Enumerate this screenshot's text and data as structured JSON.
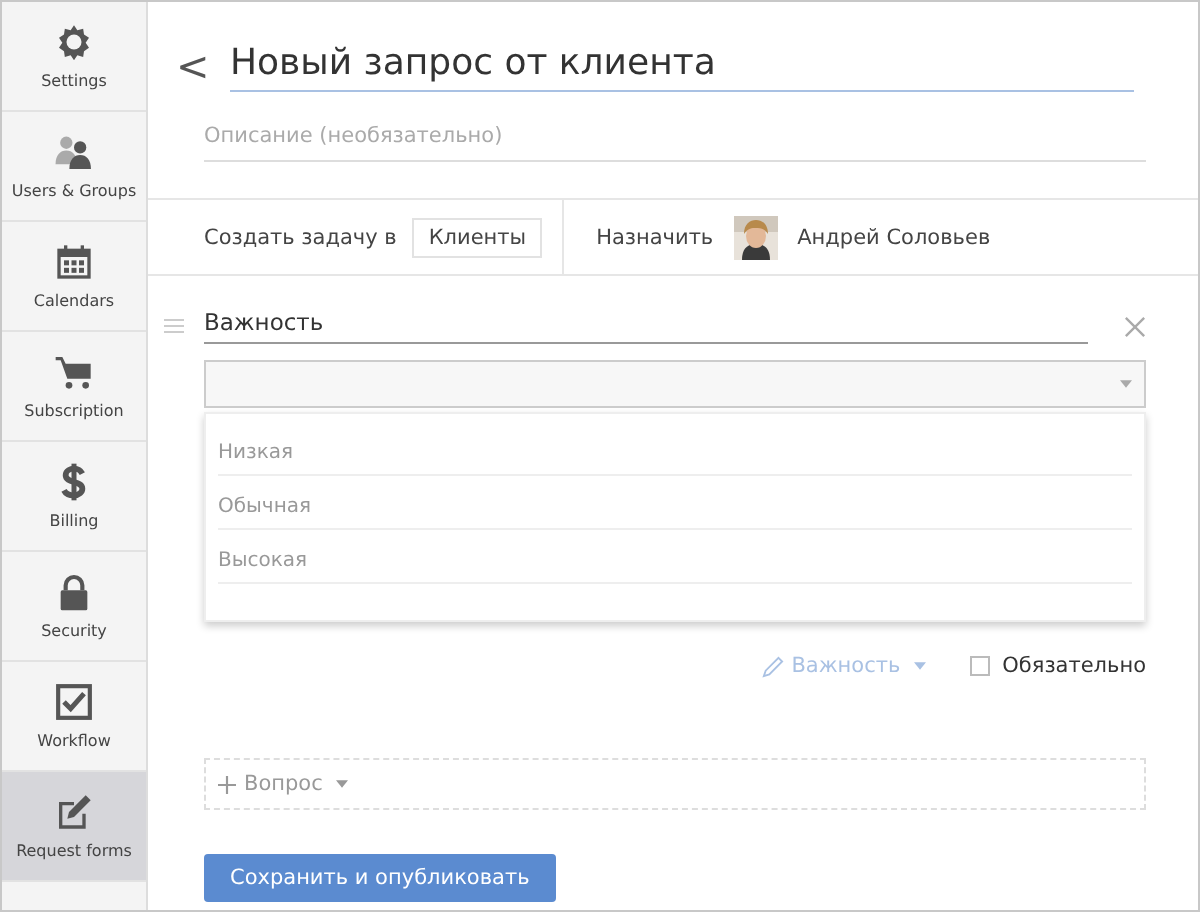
{
  "sidebar": {
    "items": [
      {
        "label": "Settings",
        "selected": false
      },
      {
        "label": "Users & Groups",
        "selected": false
      },
      {
        "label": "Calendars",
        "selected": false
      },
      {
        "label": "Subscription",
        "selected": false
      },
      {
        "label": "Billing",
        "selected": false
      },
      {
        "label": "Security",
        "selected": false
      },
      {
        "label": "Workflow",
        "selected": false
      },
      {
        "label": "Request forms",
        "selected": true
      }
    ]
  },
  "back": {
    "label": "<"
  },
  "title": "Новый запрос от клиента",
  "description": {
    "placeholder": "Описание (необязательно)"
  },
  "task_row": {
    "create_label": "Создать задачу в",
    "project": "Клиенты",
    "assign_label": "Назначить",
    "assignee": "Андрей Соловьев"
  },
  "question": {
    "label": "Важность",
    "options": [
      "Низкая",
      "Обычная",
      "Высокая"
    ],
    "type_label": "Важность",
    "required_label": "Обязательно",
    "required": false
  },
  "add_question": {
    "label": "Вопрос"
  },
  "save_button": "Сохранить и опубликовать"
}
